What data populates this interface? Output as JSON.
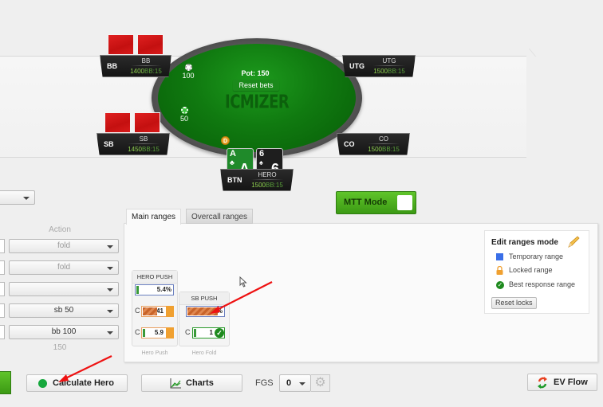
{
  "table": {
    "pot_label": "Pot: 150",
    "reset_bets": "Reset bets",
    "watermark": "ICMIZER",
    "dealer_label": "D",
    "bets": [
      {
        "seat": "BB",
        "amount": "100"
      },
      {
        "seat": "SB",
        "amount": "50"
      }
    ]
  },
  "seats": {
    "bb": {
      "position": "BB",
      "name": "BB",
      "stack": "1400",
      "bb": "BB:15"
    },
    "sb": {
      "position": "SB",
      "name": "SB",
      "stack": "1450",
      "bb": "BB:15"
    },
    "utg": {
      "position": "UTG",
      "name": "UTG",
      "stack": "1500",
      "bb": "BB:15"
    },
    "co": {
      "position": "CO",
      "name": "CO",
      "stack": "1500",
      "bb": "BB:15"
    },
    "btn": {
      "position": "BTN",
      "name": "HERO",
      "stack": "1500",
      "bb": "BB:15"
    }
  },
  "hero_cards": [
    {
      "rank": "A",
      "suit": "♣",
      "color": "#1f8a2a"
    },
    {
      "rank": "6",
      "suit": "♠",
      "color": "#1e1e1e"
    }
  ],
  "left_panel": {
    "action_header": "Action",
    "actions": [
      "fold",
      "fold",
      "",
      "sb 50",
      "bb 100"
    ],
    "total": "150"
  },
  "mtt_mode": {
    "label": "MTT Mode",
    "checked": false
  },
  "tabs": [
    {
      "label": "Main ranges",
      "active": true
    },
    {
      "label": "Overcall ranges",
      "active": false
    }
  ],
  "range_cards": [
    {
      "title": "HERO PUSH",
      "push_value": "5.4%",
      "call_rows": [
        {
          "label": "C",
          "value": "41",
          "state": "locked"
        },
        {
          "label": "C",
          "value": "5.9",
          "state": "locked"
        }
      ],
      "footer": "Hero Push"
    },
    {
      "title": "SB PUSH",
      "push_value": "60%",
      "call_rows": [
        {
          "label": "C",
          "value": "1",
          "state": "best-response"
        }
      ],
      "footer": "Hero Fold"
    }
  ],
  "legend": {
    "title": "Edit ranges mode",
    "items": [
      {
        "icon": "square-icon",
        "label": "Temporary range",
        "color": "#3a6fe8"
      },
      {
        "icon": "lock-icon",
        "label": "Locked range",
        "color": "#f0a030"
      },
      {
        "icon": "check-circle-icon",
        "label": "Best response range",
        "color": "#1e8a1e"
      }
    ],
    "reset_locks": "Reset locks"
  },
  "bottom_bar": {
    "calculate_hero": "Calculate Hero",
    "charts": "Charts",
    "fgs_label": "FGS",
    "fgs_value": "0",
    "ev_flow": "EV Flow"
  }
}
